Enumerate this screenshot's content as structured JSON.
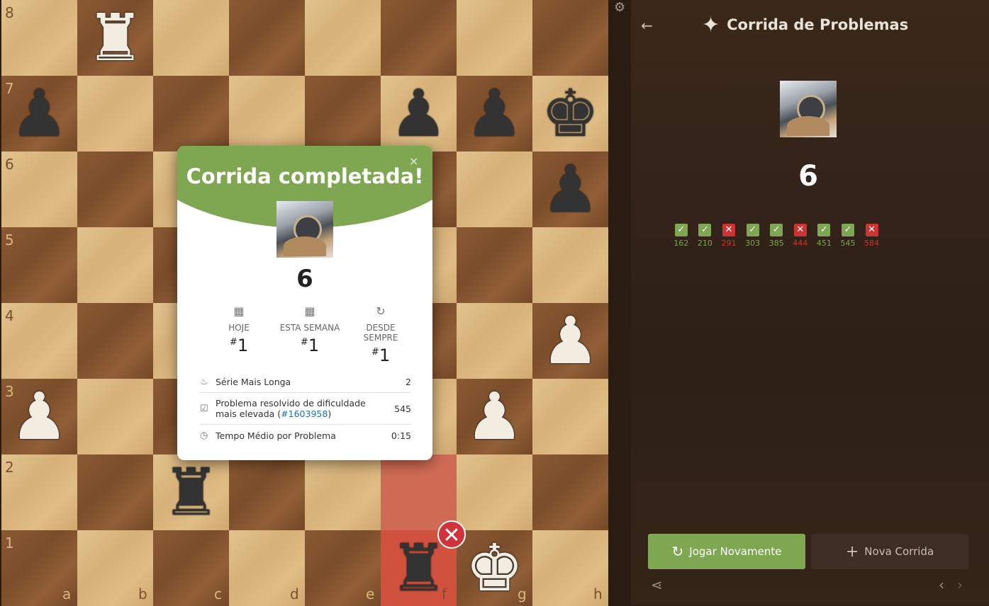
{
  "board": {
    "ranks": [
      "8",
      "7",
      "6",
      "5",
      "4",
      "3",
      "2",
      "1"
    ],
    "files": [
      "a",
      "b",
      "c",
      "d",
      "e",
      "f",
      "g",
      "h"
    ],
    "pieces": [
      {
        "sq": "b8",
        "glyph": "♜",
        "color": "w",
        "name": "white-rook-b8"
      },
      {
        "sq": "a7",
        "glyph": "♟",
        "color": "b",
        "name": "black-pawn-a7"
      },
      {
        "sq": "f7",
        "glyph": "♟",
        "color": "b",
        "name": "black-pawn-f7"
      },
      {
        "sq": "g7",
        "glyph": "♟",
        "color": "b",
        "name": "black-pawn-g7"
      },
      {
        "sq": "h7",
        "glyph": "♚",
        "color": "b",
        "name": "black-king-h7"
      },
      {
        "sq": "h6",
        "glyph": "♟",
        "color": "b",
        "name": "black-pawn-h6"
      },
      {
        "sq": "h4",
        "glyph": "♟",
        "color": "w",
        "name": "white-pawn-h4"
      },
      {
        "sq": "a3",
        "glyph": "♟",
        "color": "w",
        "name": "white-pawn-a3"
      },
      {
        "sq": "g3",
        "glyph": "♟",
        "color": "w",
        "name": "white-pawn-g3"
      },
      {
        "sq": "c2",
        "glyph": "♜",
        "color": "b",
        "name": "black-rook-c2"
      },
      {
        "sq": "f1",
        "glyph": "♜",
        "color": "b",
        "name": "black-rook-f1"
      },
      {
        "sq": "g1",
        "glyph": "♚",
        "color": "w",
        "name": "white-king-g1"
      }
    ],
    "highlights": [
      "f2",
      "f1"
    ],
    "wrong_mark_icon": "x-circle-icon"
  },
  "modal": {
    "title": "Corrida completada!",
    "close_icon": "×",
    "score": "6",
    "ranks": [
      {
        "label": "HOJE",
        "value": "1",
        "icon": "calendar-icon"
      },
      {
        "label": "ESTA SEMANA",
        "value": "1",
        "icon": "calendar-icon"
      },
      {
        "label": "DESDE SEMPRE",
        "value": "1",
        "icon": "refresh-icon"
      }
    ],
    "stats": {
      "streak_label": "Série Mais Longa",
      "streak_value": "2",
      "hardest_label_pre": "Problema resolvido de dificuldade mais elevada (",
      "hardest_link": "#1603958",
      "hardest_label_post": ")",
      "hardest_value": "545",
      "time_label": "Tempo Médio por Problema",
      "time_value": "0:15"
    }
  },
  "sidebar": {
    "title": "Corrida de Problemas",
    "score": "6",
    "results": [
      {
        "ok": true,
        "rating": "162"
      },
      {
        "ok": true,
        "rating": "210"
      },
      {
        "ok": false,
        "rating": "291"
      },
      {
        "ok": true,
        "rating": "303"
      },
      {
        "ok": true,
        "rating": "385"
      },
      {
        "ok": false,
        "rating": "444"
      },
      {
        "ok": true,
        "rating": "451"
      },
      {
        "ok": true,
        "rating": "545"
      },
      {
        "ok": false,
        "rating": "584"
      }
    ],
    "play_again": "Jogar Novamente",
    "new_run": "Nova Corrida"
  },
  "colors": {
    "accent": "#7fa650",
    "error": "#cc3333"
  }
}
